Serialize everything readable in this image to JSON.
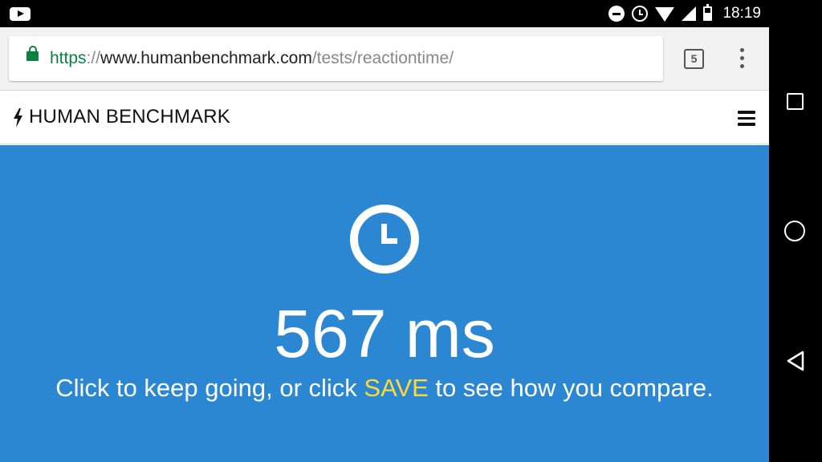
{
  "statusbar": {
    "time": "18:19",
    "icons": [
      "youtube-notification-icon",
      "do-not-disturb-icon",
      "alarm-icon",
      "wifi-icon",
      "signal-icon",
      "battery-icon"
    ]
  },
  "browser": {
    "url": {
      "scheme": "https",
      "separator": "://",
      "host": "www.humanbenchmark.com",
      "path": "/tests/reactiontime/"
    },
    "tab_count": "5",
    "secure": true
  },
  "site": {
    "brand": "HUMAN BENCHMARK",
    "brand_icon": "lightning-bolt-icon",
    "menu_icon": "hamburger-menu-icon"
  },
  "test": {
    "icon": "clock-icon",
    "result": "567 ms",
    "hint_before": "Click to keep going, or click ",
    "hint_save": "SAVE",
    "hint_after": " to see how you compare."
  },
  "colors": {
    "main_background": "#2b87d1",
    "save_highlight": "#ffd83b",
    "secure_green": "#0b8043"
  },
  "navbar": {
    "buttons": [
      "recents-button",
      "home-button",
      "back-button"
    ]
  }
}
